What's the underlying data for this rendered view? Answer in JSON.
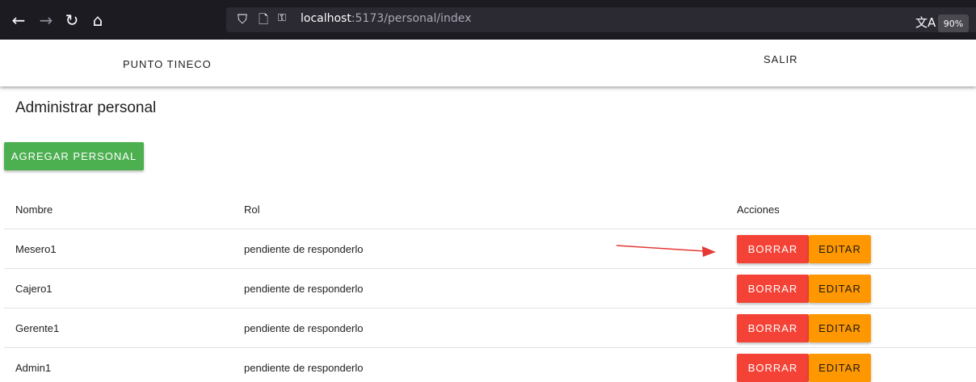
{
  "browser": {
    "url_host": "localhost",
    "url_rest": ":5173/personal/index",
    "zoom": "90%"
  },
  "header": {
    "brand": "PUNTO TINECO",
    "logout": "SALIR"
  },
  "page": {
    "title": "Administrar personal",
    "add_button": "AGREGAR PERSONAL"
  },
  "table": {
    "columns": [
      "Nombre",
      "Rol",
      "Acciones"
    ],
    "rows": [
      {
        "nombre": "Mesero1",
        "rol": "pendiente de responderlo"
      },
      {
        "nombre": "Cajero1",
        "rol": "pendiente de responderlo"
      },
      {
        "nombre": "Gerente1",
        "rol": "pendiente de responderlo"
      },
      {
        "nombre": "Admin1",
        "rol": "pendiente de responderlo"
      }
    ],
    "delete_label": "BORRAR",
    "edit_label": "EDITAR"
  },
  "colors": {
    "add": "#4caf50",
    "delete": "#f44336",
    "edit": "#ff9800",
    "annotation_arrow": "#e53935"
  }
}
